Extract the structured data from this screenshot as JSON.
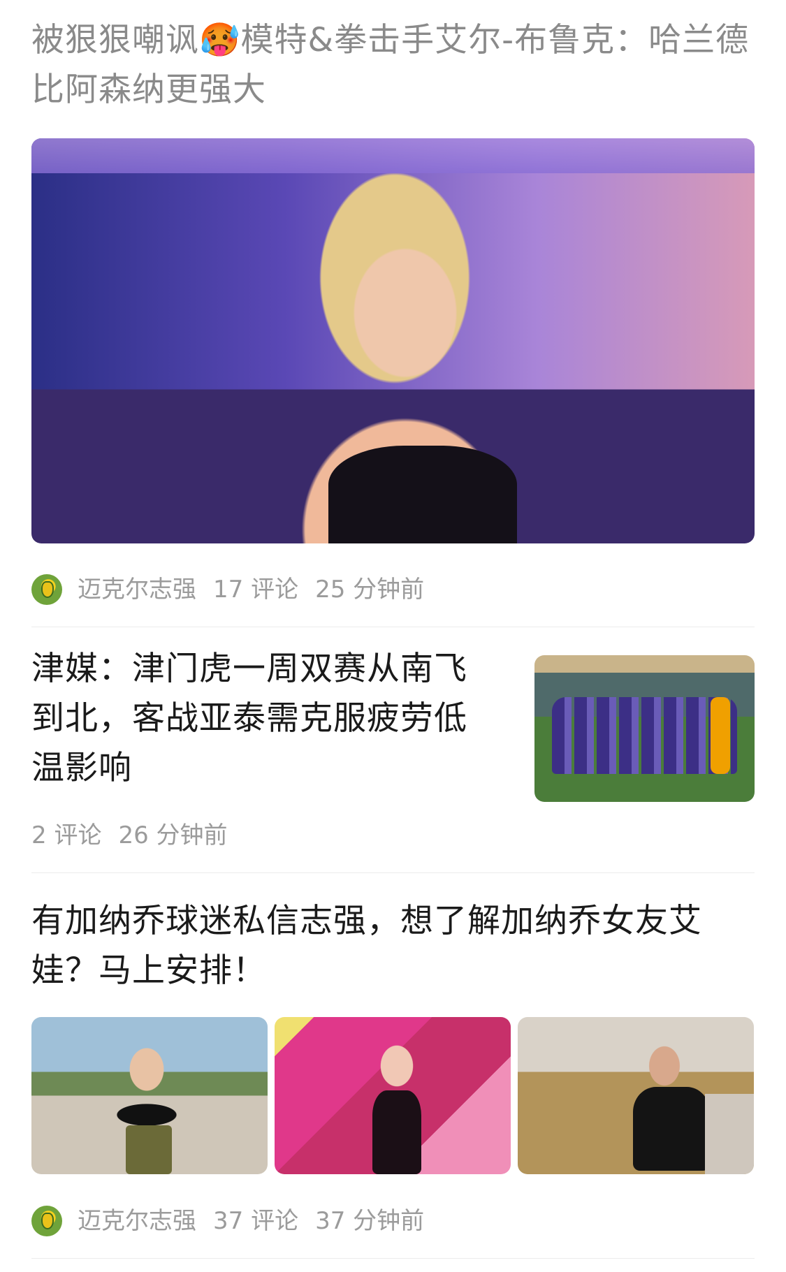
{
  "articles": [
    {
      "title": "被狠狠嘲讽🥵模特&拳击手艾尔-布鲁克：哈兰德比阿森纳更强大",
      "author": "迈克尔志强",
      "comments": "17 评论",
      "time": "25 分钟前"
    },
    {
      "title": "津媒：津门虎一周双赛从南飞到北，客战亚泰需克服疲劳低温影响",
      "comments": "2 评论",
      "time": "26 分钟前"
    },
    {
      "title": "有加纳乔球迷私信志强，想了解加纳乔女友艾娃？马上安排！",
      "author": "迈克尔志强",
      "comments": "37 评论",
      "time": "37 分钟前"
    }
  ],
  "colors": {
    "read_title": "#8a8a8a",
    "title": "#1a1a1a",
    "meta": "#9b9b9b",
    "divider": "#ececec"
  }
}
